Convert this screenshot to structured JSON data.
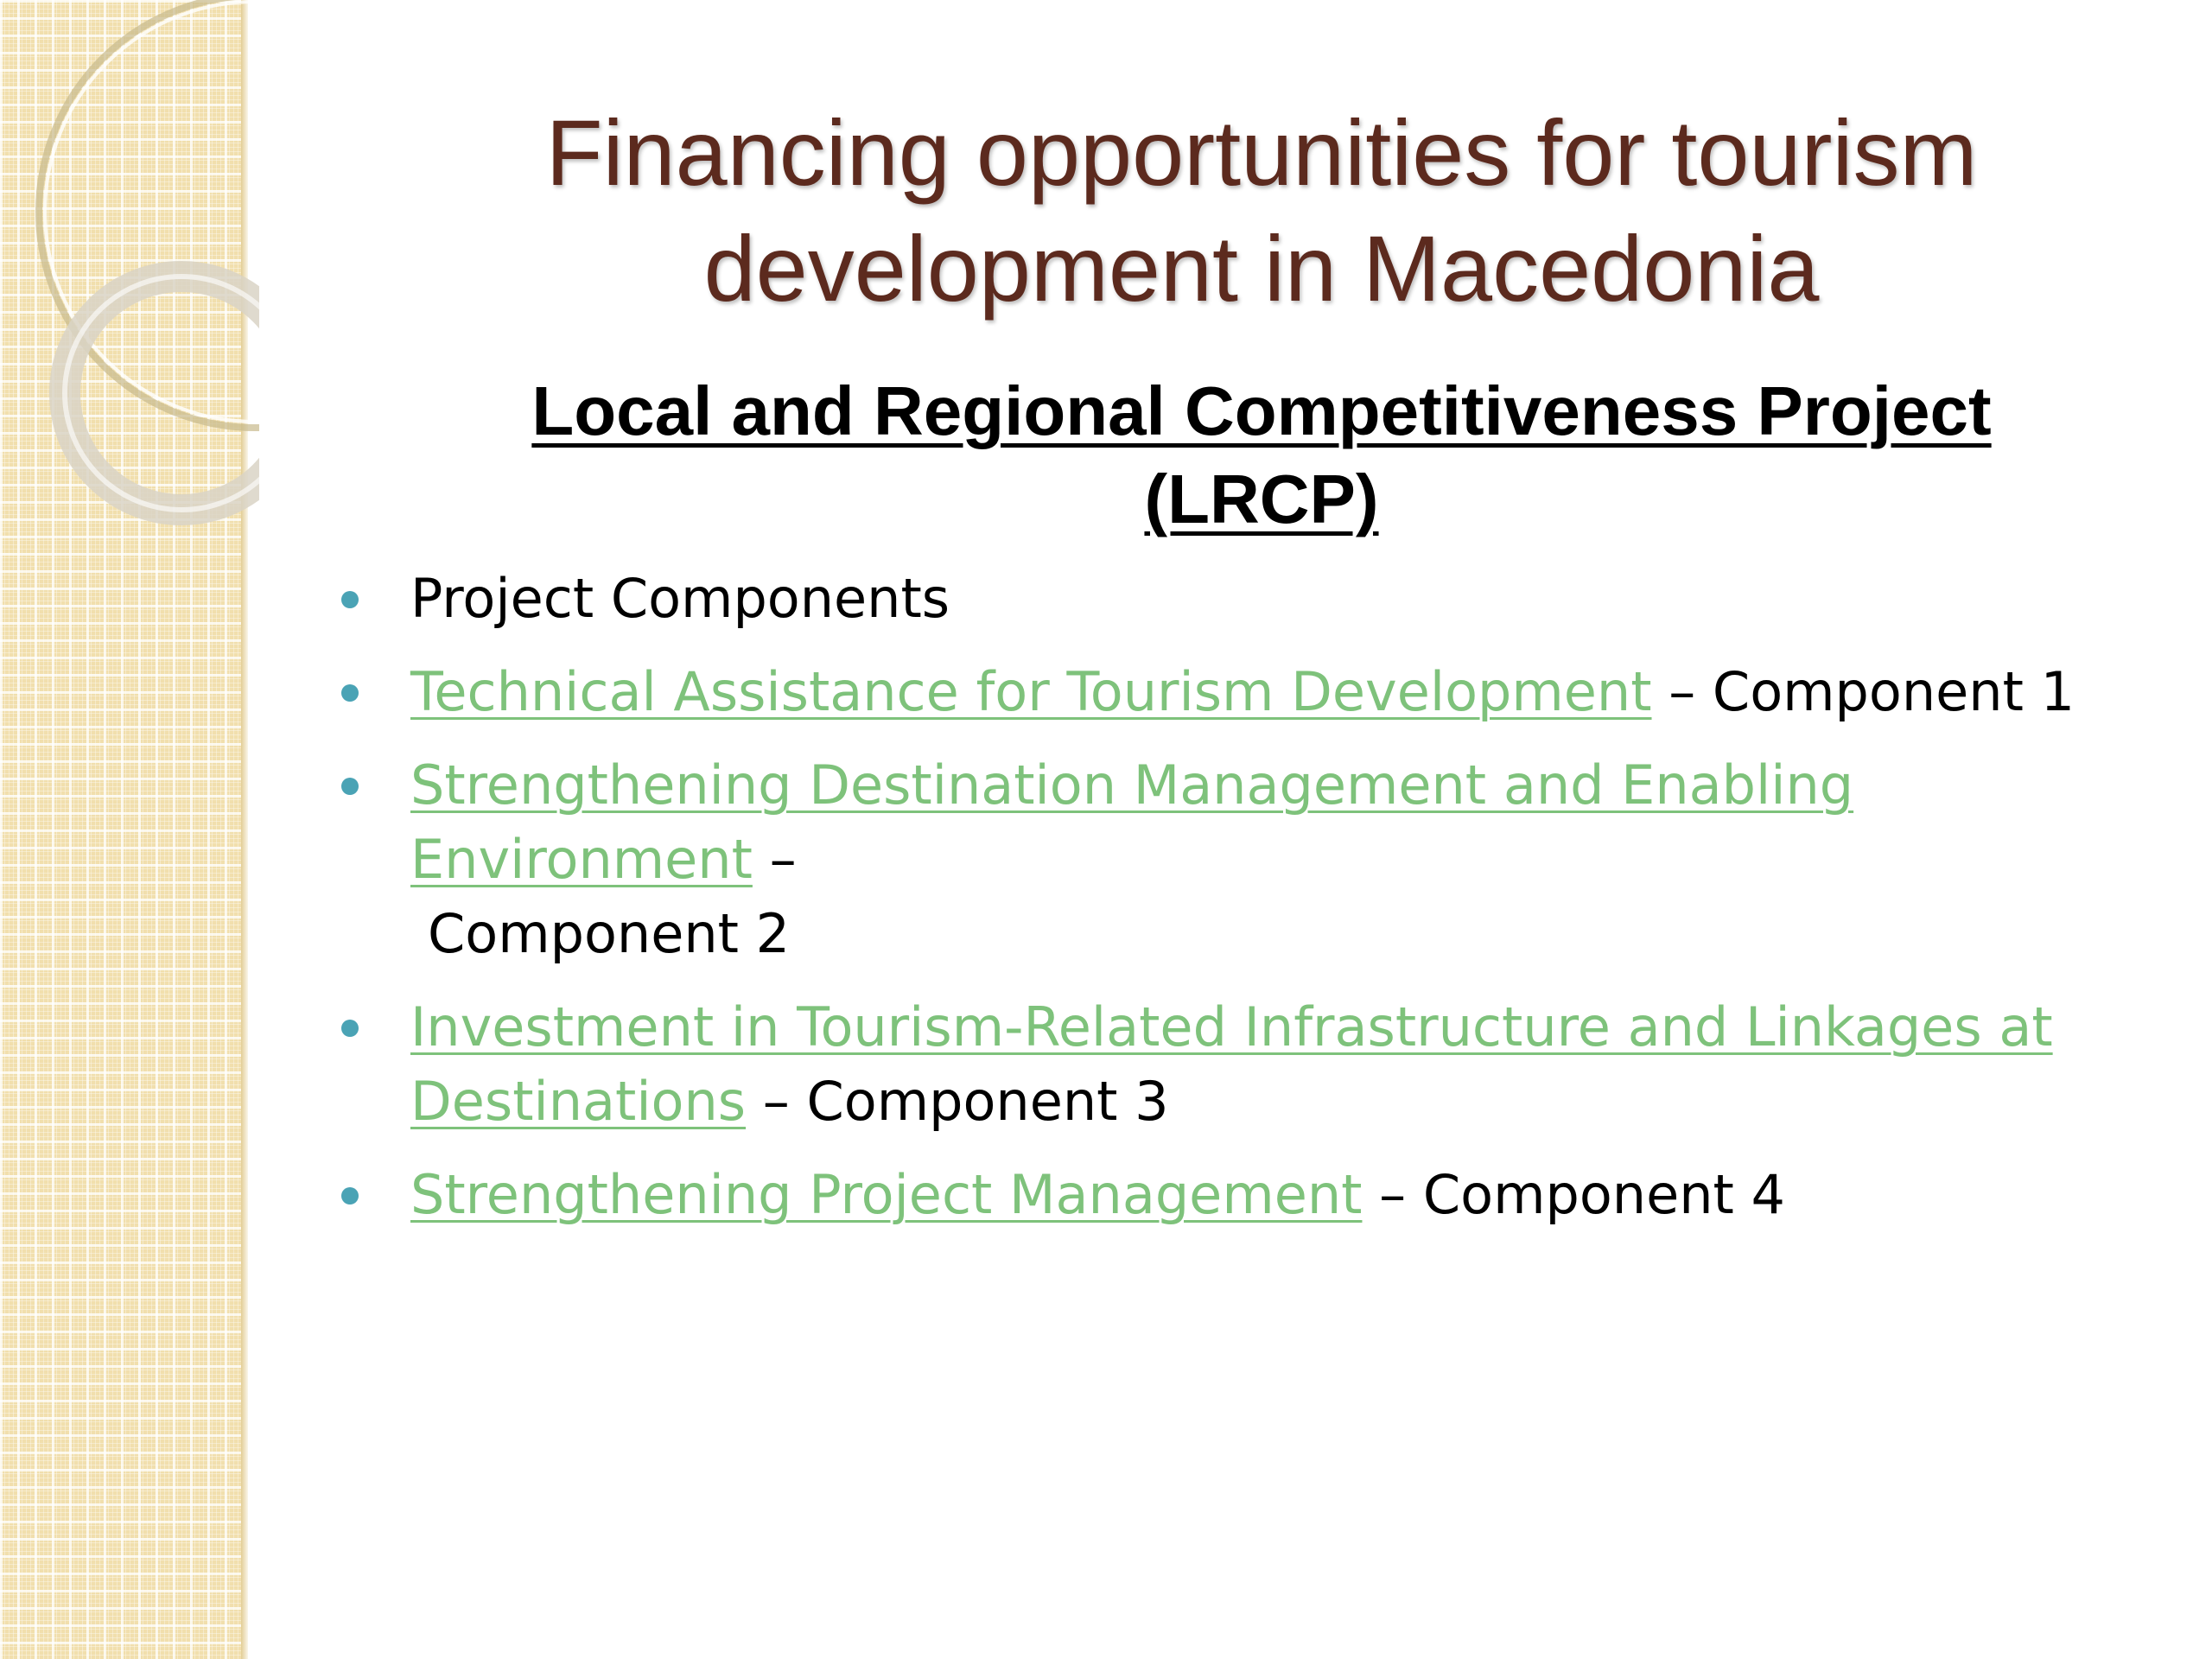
{
  "slide": {
    "title_line1": "Financing opportunities for tourism",
    "title_line2": "development in Macedonia",
    "subtitle_line1": "Local and Regional Competitiveness Project",
    "subtitle_line2": "(LRCP)",
    "bullets": [
      {
        "text": "Project Components"
      },
      {
        "link": "Technical Assistance for Tourism Development",
        "suffix": " – Component 1"
      },
      {
        "link": "Strengthening Destination Management and Enabling Environment",
        "suffix": " –",
        "suffix_line2": "Component 2"
      },
      {
        "link": "Investment in Tourism-Related Infrastructure and Linkages at Destinations",
        "suffix": " – Component 3"
      },
      {
        "link": "Strengthening Project Management",
        "suffix": " – Component 4"
      }
    ]
  },
  "colors": {
    "title": "#5c2a1e",
    "link": "#7ec27b",
    "bullet": "#4aa3b5",
    "side_panel": "#f1dfad"
  }
}
